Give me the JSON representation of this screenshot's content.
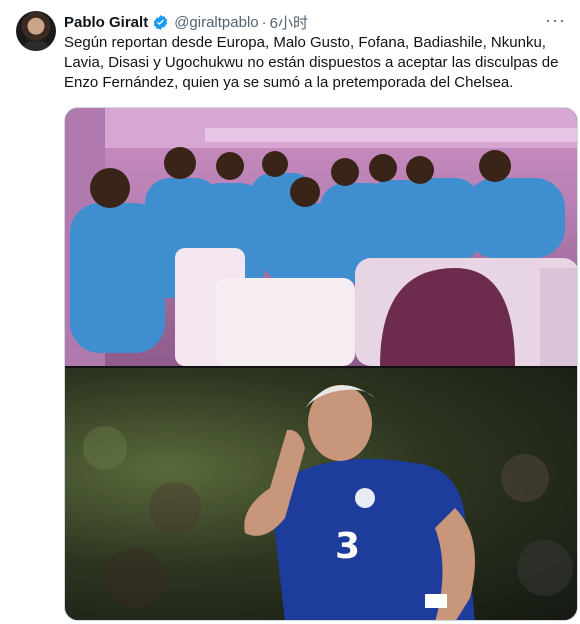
{
  "tweet": {
    "author_name": "Pablo Giralt",
    "handle": "@giraltpablo",
    "separator": "·",
    "time": "6小时",
    "more_label": "···",
    "text": "Según reportan desde Europa, Malo Gusto, Fofana, Badiashile, Nkunku, Lavia, Disasi y Ugochukwu no están dispuestos a aceptar las disculpas de Enzo Fernández, quien ya se sumó a la pretemporada del Chelsea.",
    "verified_color": "#1d9bf0",
    "images": [
      {
        "icon": "photo-players-airplane"
      },
      {
        "icon": "photo-player-chelsea-kit",
        "kit_colors": [
          "#1d3c9c",
          "#0c2070"
        ]
      }
    ]
  }
}
